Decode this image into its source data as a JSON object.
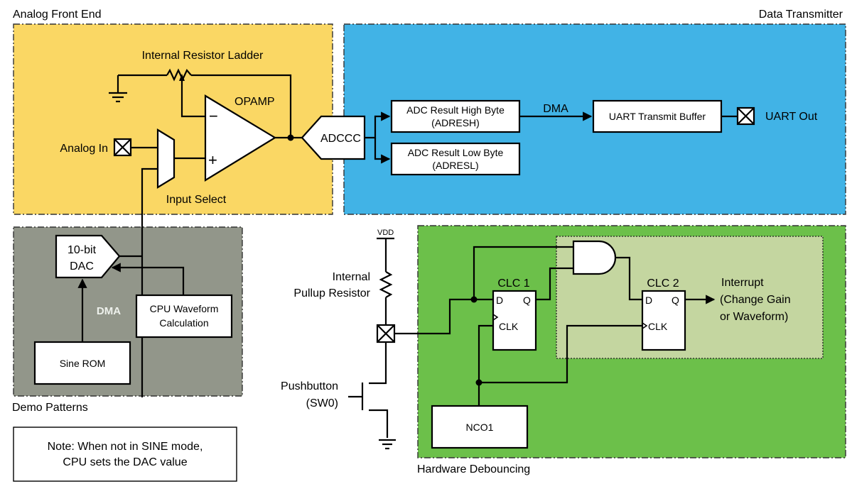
{
  "regions": {
    "analog_front_end": {
      "title": "Analog Front End",
      "color": "#FAD764"
    },
    "data_transmitter": {
      "title": "Data Transmitter",
      "color": "#41B3E6"
    },
    "demo_patterns": {
      "title": "Demo Patterns",
      "color": "#92968A"
    },
    "hardware_debouncing": {
      "title": "Hardware Debouncing",
      "color": "#6CC04A",
      "inner_color": "#C4D6A0"
    }
  },
  "afe": {
    "resistor_ladder": "Internal Resistor Ladder",
    "opamp": "OPAMP",
    "opamp_minus": "−",
    "opamp_plus": "+",
    "analog_in": "Analog In",
    "input_select": "Input Select"
  },
  "adc": {
    "adccc": "ADCCC",
    "high_byte_line1": "ADC Result High Byte",
    "high_byte_line2": "(ADRESH)",
    "low_byte_line1": "ADC Result Low Byte",
    "low_byte_line2": "(ADRESL)",
    "dma": "DMA",
    "uart_buffer": "UART Transmit Buffer",
    "uart_out": "UART Out"
  },
  "demo": {
    "dac_line1": "10-bit",
    "dac_line2": "DAC",
    "dma": "DMA",
    "cpu_line1": "CPU Waveform",
    "cpu_line2": "Calculation",
    "sine_rom": "Sine ROM"
  },
  "note": {
    "line1": "Note: When not in SINE mode,",
    "line2": "CPU sets the DAC value"
  },
  "debounce": {
    "vdd": "VDD",
    "pullup_line1": "Internal",
    "pullup_line2": "Pullup Resistor",
    "pushbutton_line1": "Pushbutton",
    "pushbutton_line2": "(SW0)",
    "clc1": "CLC 1",
    "clc2": "CLC 2",
    "d": "D",
    "q": "Q",
    "clk": "CLK",
    "nco": "NCO1",
    "interrupt_line1": "Interrupt",
    "interrupt_line2": "(Change Gain",
    "interrupt_line3": "or Waveform)"
  }
}
